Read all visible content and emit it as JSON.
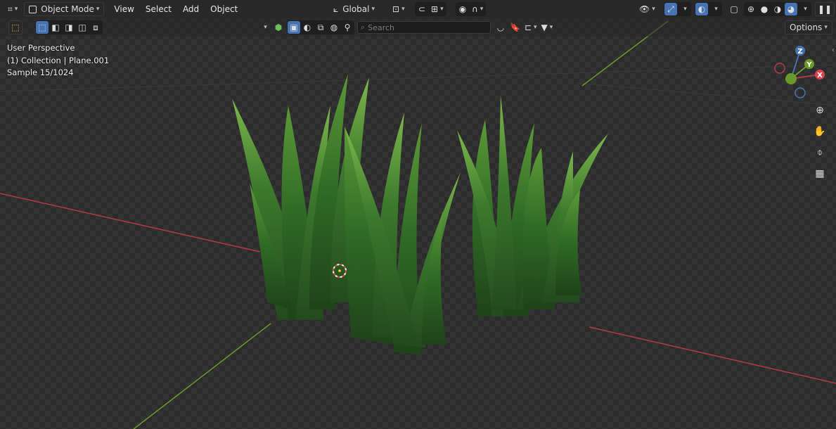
{
  "header": {
    "editor_type_icon": "axis-grid-icon",
    "mode_label": "Object Mode",
    "menus": [
      "View",
      "Select",
      "Add",
      "Object"
    ],
    "transform_orientation": "Global"
  },
  "toolbar2": {
    "search_placeholder": "Search",
    "options_label": "Options"
  },
  "overlay": {
    "view_name": "User Perspective",
    "collection_info": "(1) Collection | Plane.001",
    "sample_info": "Sample 15/1024"
  },
  "gizmo": {
    "z": "Z",
    "y": "Y",
    "x": "X"
  },
  "colors": {
    "x_axis": "#b33a44",
    "y_axis": "#6a9a2a",
    "active_blue": "#4772b3",
    "grass_dark": "#2e5a25",
    "grass_light": "#7ab84a"
  }
}
